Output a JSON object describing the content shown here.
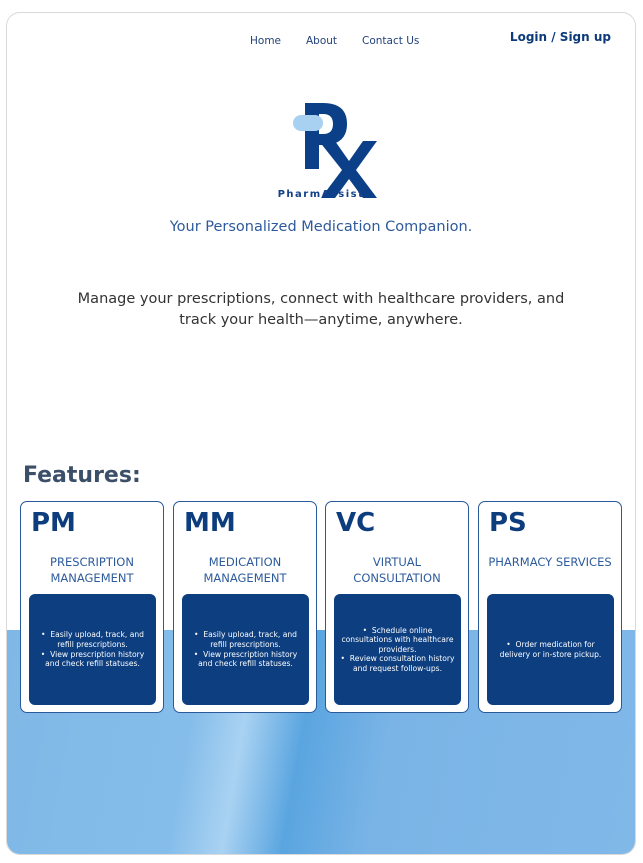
{
  "nav": {
    "home": "Home",
    "about": "About",
    "contact": "Contact Us",
    "login": "Login / Sign up"
  },
  "brand": {
    "name": "PharmAssist",
    "tagline": "Your Personalized Medication Companion."
  },
  "hero": {
    "description": "Manage your prescriptions, connect with healthcare providers, and track your health—anytime, anywhere."
  },
  "features": {
    "title": "Features:",
    "cards": [
      {
        "abbr": "PM",
        "name": "PRESCRIPTION MANAGEMENT",
        "bullets": [
          "Easily upload, track, and refill prescriptions.",
          "View prescription history and check refill statuses."
        ]
      },
      {
        "abbr": "MM",
        "name": "MEDICATION MANAGEMENT",
        "bullets": [
          "Easily upload, track, and refill prescriptions.",
          "View prescription history and check refill statuses."
        ]
      },
      {
        "abbr": "VC",
        "name": "VIRTUAL CONSULTATION",
        "bullets": [
          "Schedule online consultations with healthcare providers.",
          "Review consultation history and request follow-ups."
        ]
      },
      {
        "abbr": "PS",
        "name": "PHARMACY SERVICES",
        "bullets": [
          "Order medication for delivery or in-store pickup."
        ]
      }
    ]
  },
  "colors": {
    "primary": "#0c3e80",
    "accent": "#2e5a9c",
    "band": "#7fb8e6"
  }
}
